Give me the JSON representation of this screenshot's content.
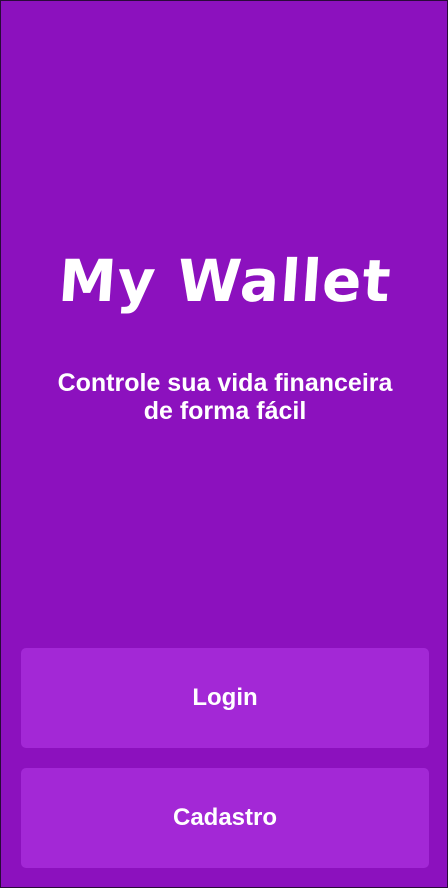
{
  "app": {
    "logo_text": "My Wallet",
    "tagline_line1": "Controle sua vida financeira",
    "tagline_line2": "de forma fácil"
  },
  "actions": {
    "login_label": "Login",
    "signup_label": "Cadastro"
  },
  "colors": {
    "background": "#8c11be",
    "button": "#a328d6",
    "text": "#ffffff"
  }
}
